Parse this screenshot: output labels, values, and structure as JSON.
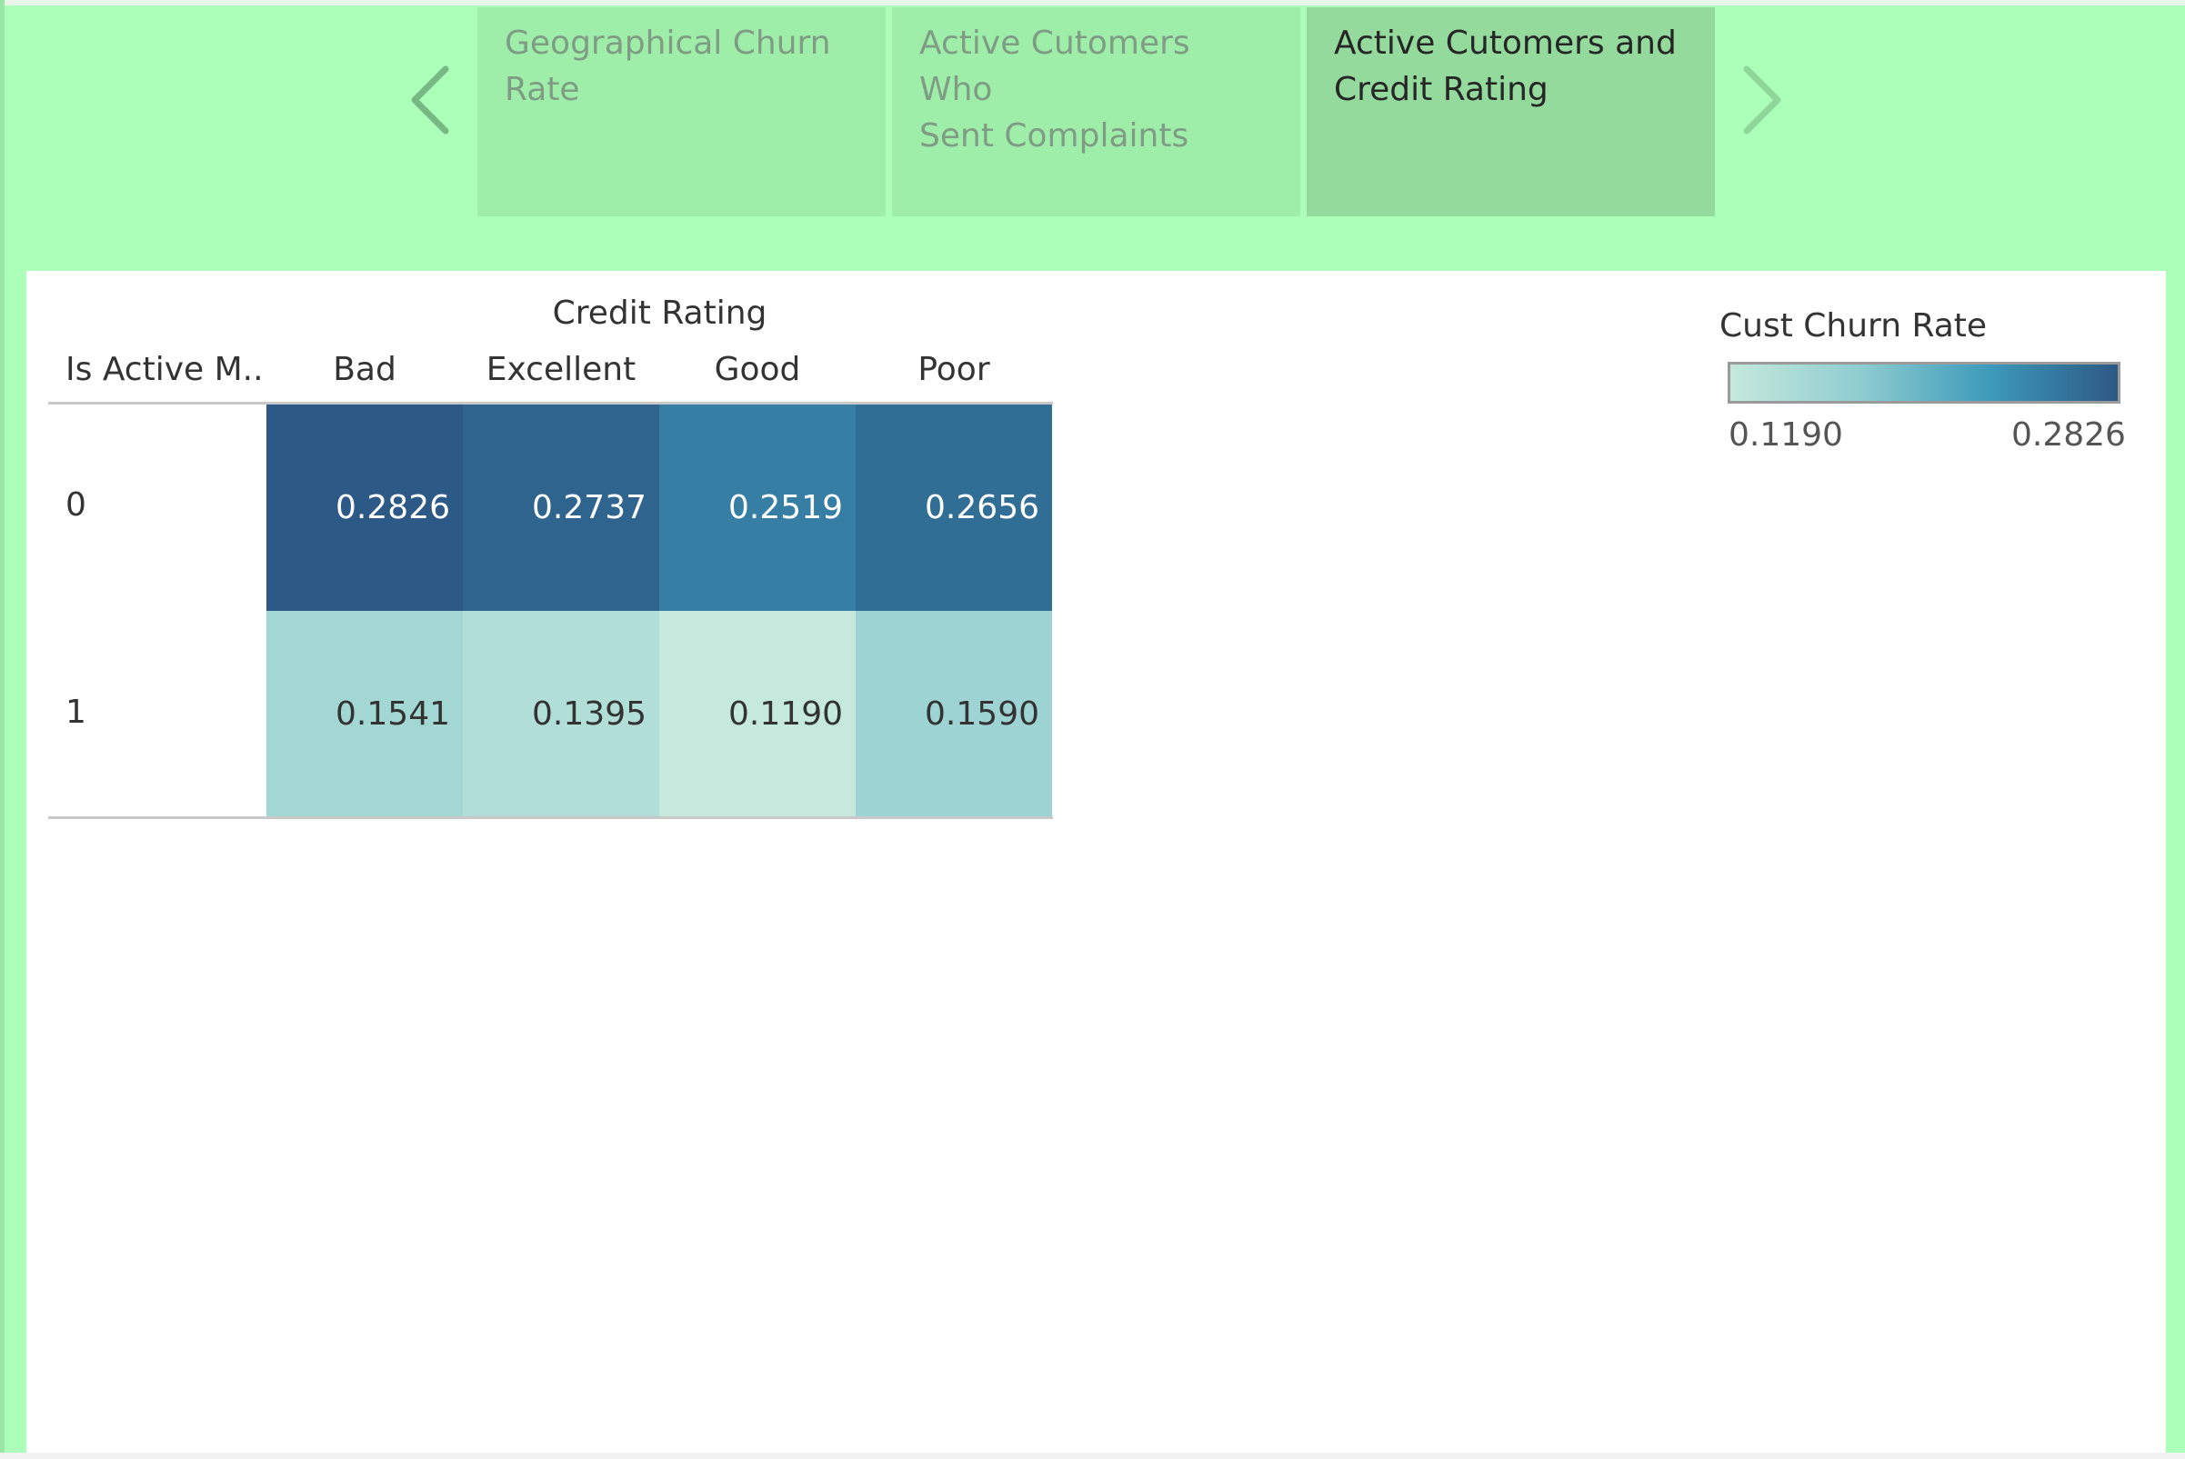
{
  "story": {
    "tabs": [
      {
        "lines": [
          "Geographical Churn",
          "Rate"
        ],
        "active": false
      },
      {
        "lines": [
          "Active Cutomers Who",
          "Sent Complaints"
        ],
        "active": false
      },
      {
        "lines": [
          "Active Cutomers and",
          "Credit Rating"
        ],
        "active": true
      }
    ],
    "prev_icon": "chevron-left-icon",
    "next_icon": "chevron-right-icon"
  },
  "chart_data": {
    "type": "heatmap",
    "column_header": "Credit Rating",
    "row_header": "Is Active M..",
    "columns": [
      "Bad",
      "Excellent",
      "Good",
      "Poor"
    ],
    "rows": [
      "0",
      "1"
    ],
    "values": [
      [
        0.2826,
        0.2737,
        0.2519,
        0.2656
      ],
      [
        0.1541,
        0.1395,
        0.119,
        0.159
      ]
    ],
    "value_labels": [
      [
        "0.2826",
        "0.2737",
        "0.2519",
        "0.2656"
      ],
      [
        "0.1541",
        "0.1395",
        "0.1190",
        "0.1590"
      ]
    ],
    "legend": {
      "title": "Cust Churn Rate",
      "min_label": "0.1190",
      "max_label": "0.2826",
      "min": 0.119,
      "max": 0.2826,
      "color_stops": [
        "#c5e9dc",
        "#8fcdd0",
        "#3d9bbb",
        "#2c5985"
      ]
    }
  }
}
